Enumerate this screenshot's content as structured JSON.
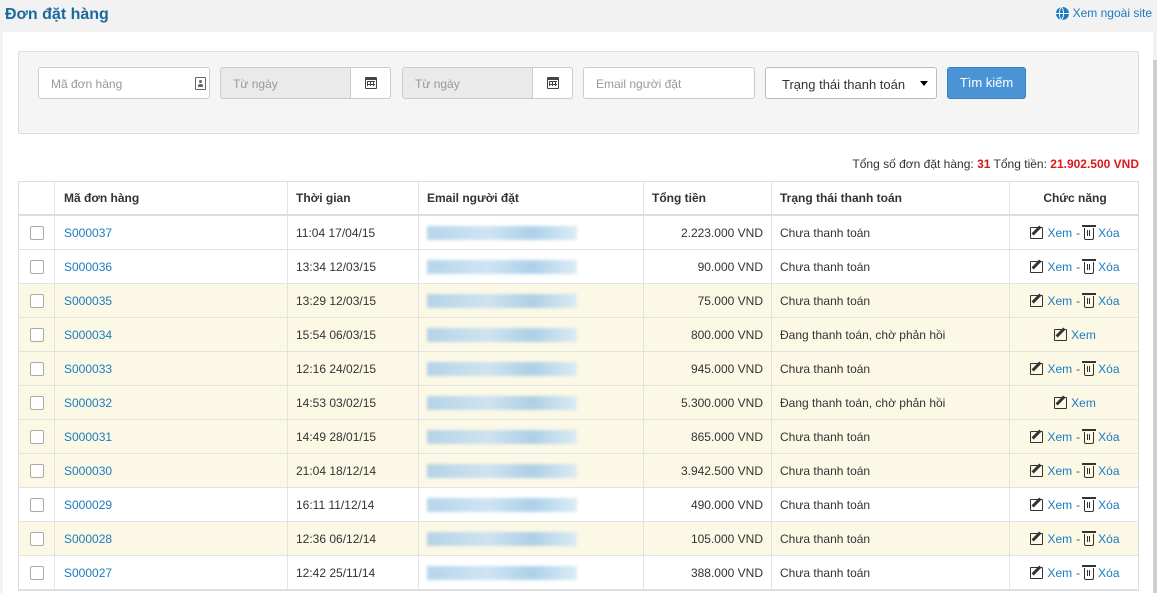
{
  "header": {
    "title": "Đơn đặt hàng",
    "external_link": "Xem ngoài site"
  },
  "filters": {
    "order_code_placeholder": "Mã đơn hàng",
    "from_date_placeholder": "Từ ngày",
    "to_date_placeholder": "Từ ngày",
    "email_placeholder": "Email người đặt",
    "payment_status_selected": "Trạng thái thanh toán",
    "search_label": "Tìm kiếm"
  },
  "summary": {
    "orders_label": "Tổng số đơn đặt hàng:",
    "orders_count": "31",
    "total_label": "Tổng tiền:",
    "total_amount": "21.902.500 VND"
  },
  "table": {
    "headers": {
      "code": "Mã đơn hàng",
      "time": "Thời gian",
      "email": "Email người đặt",
      "total": "Tổng tiền",
      "status": "Trạng thái thanh toán",
      "actions": "Chức năng"
    },
    "view_label": "Xem",
    "delete_label": "Xóa",
    "rows": [
      {
        "code": "S000037",
        "time": "11:04 17/04/15",
        "total": "2.223.000 VND",
        "status": "Chưa thanh toán",
        "alt": false
      },
      {
        "code": "S000036",
        "time": "13:34 12/03/15",
        "total": "90.000 VND",
        "status": "Chưa thanh toán",
        "alt": false
      },
      {
        "code": "S000035",
        "time": "13:29 12/03/15",
        "total": "75.000 VND",
        "status": "Chưa thanh toán",
        "alt": true
      },
      {
        "code": "S000034",
        "time": "15:54 06/03/15",
        "total": "800.000 VND",
        "status": "Đang thanh toán, chờ phản hồi",
        "alt": true
      },
      {
        "code": "S000033",
        "time": "12:16 24/02/15",
        "total": "945.000 VND",
        "status": "Chưa thanh toán",
        "alt": true
      },
      {
        "code": "S000032",
        "time": "14:53 03/02/15",
        "total": "5.300.000 VND",
        "status": "Đang thanh toán, chờ phản hồi",
        "alt": true
      },
      {
        "code": "S000031",
        "time": "14:49 28/01/15",
        "total": "865.000 VND",
        "status": "Chưa thanh toán",
        "alt": true
      },
      {
        "code": "S000030",
        "time": "21:04 18/12/14",
        "total": "3.942.500 VND",
        "status": "Chưa thanh toán",
        "alt": true
      },
      {
        "code": "S000029",
        "time": "16:11 11/12/14",
        "total": "490.000 VND",
        "status": "Chưa thanh toán",
        "alt": false
      },
      {
        "code": "S000028",
        "time": "12:36 06/12/14",
        "total": "105.000 VND",
        "status": "Chưa thanh toán",
        "alt": true
      },
      {
        "code": "S000027",
        "time": "12:42 25/11/14",
        "total": "388.000 VND",
        "status": "Chưa thanh toán",
        "alt": false
      }
    ]
  }
}
